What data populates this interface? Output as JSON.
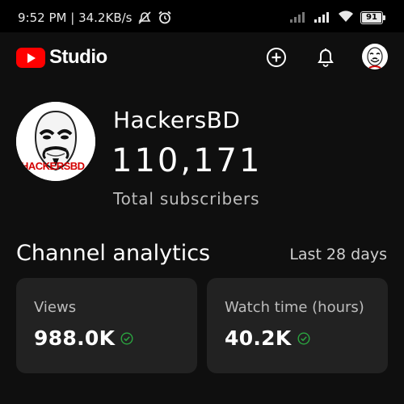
{
  "status_bar": {
    "time": "9:52 PM",
    "separator": "|",
    "speed": "34.2KB/s",
    "battery": "91"
  },
  "app_bar": {
    "logo_text": "Studio",
    "icons": [
      "create-icon",
      "notifications-bell-icon",
      "account-avatar"
    ]
  },
  "channel": {
    "name": "HackersBD",
    "subscriber_count": "110,171",
    "subscriber_label": "Total subscribers",
    "avatar_text": "HACKERSBD"
  },
  "analytics": {
    "title": "Channel analytics",
    "period": "Last 28 days",
    "cards": [
      {
        "label": "Views",
        "value": "988.0K"
      },
      {
        "label": "Watch time (hours)",
        "value": "40.2K"
      }
    ]
  },
  "colors": {
    "brand_red": "#ff0000",
    "background": "#0f0f0f",
    "card": "#222222",
    "check_green": "#2ba640"
  }
}
